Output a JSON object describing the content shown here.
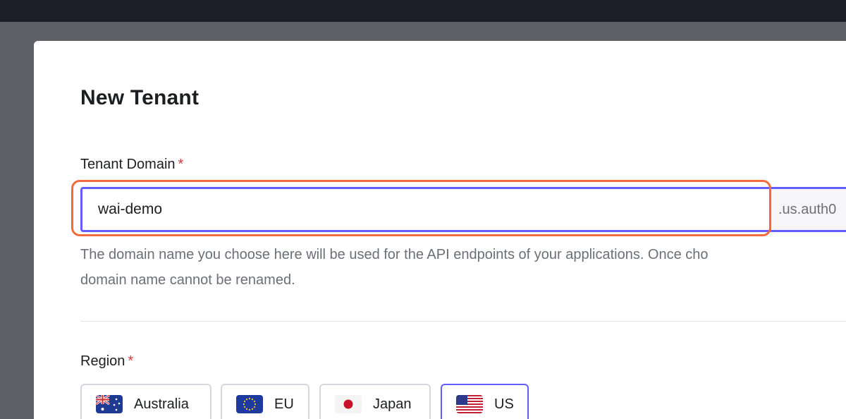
{
  "dialog": {
    "title": "New Tenant"
  },
  "tenant_domain": {
    "label": "Tenant Domain",
    "required_marker": "*",
    "value": "wai-demo",
    "suffix": ".us.auth0",
    "help_line1": "The domain name you choose here will be used for the API endpoints of your applications. Once cho",
    "help_line2": "domain name cannot be renamed."
  },
  "region": {
    "label": "Region",
    "required_marker": "*",
    "options": [
      {
        "label": "Australia",
        "icon": "australia-flag-icon",
        "selected": false
      },
      {
        "label": "EU",
        "icon": "eu-flag-icon",
        "selected": false
      },
      {
        "label": "Japan",
        "icon": "japan-flag-icon",
        "selected": false
      },
      {
        "label": "US",
        "icon": "us-flag-icon",
        "selected": true
      }
    ]
  },
  "colors": {
    "accent": "#635dff",
    "highlight": "#f26b3a",
    "required": "#d43a3a"
  }
}
